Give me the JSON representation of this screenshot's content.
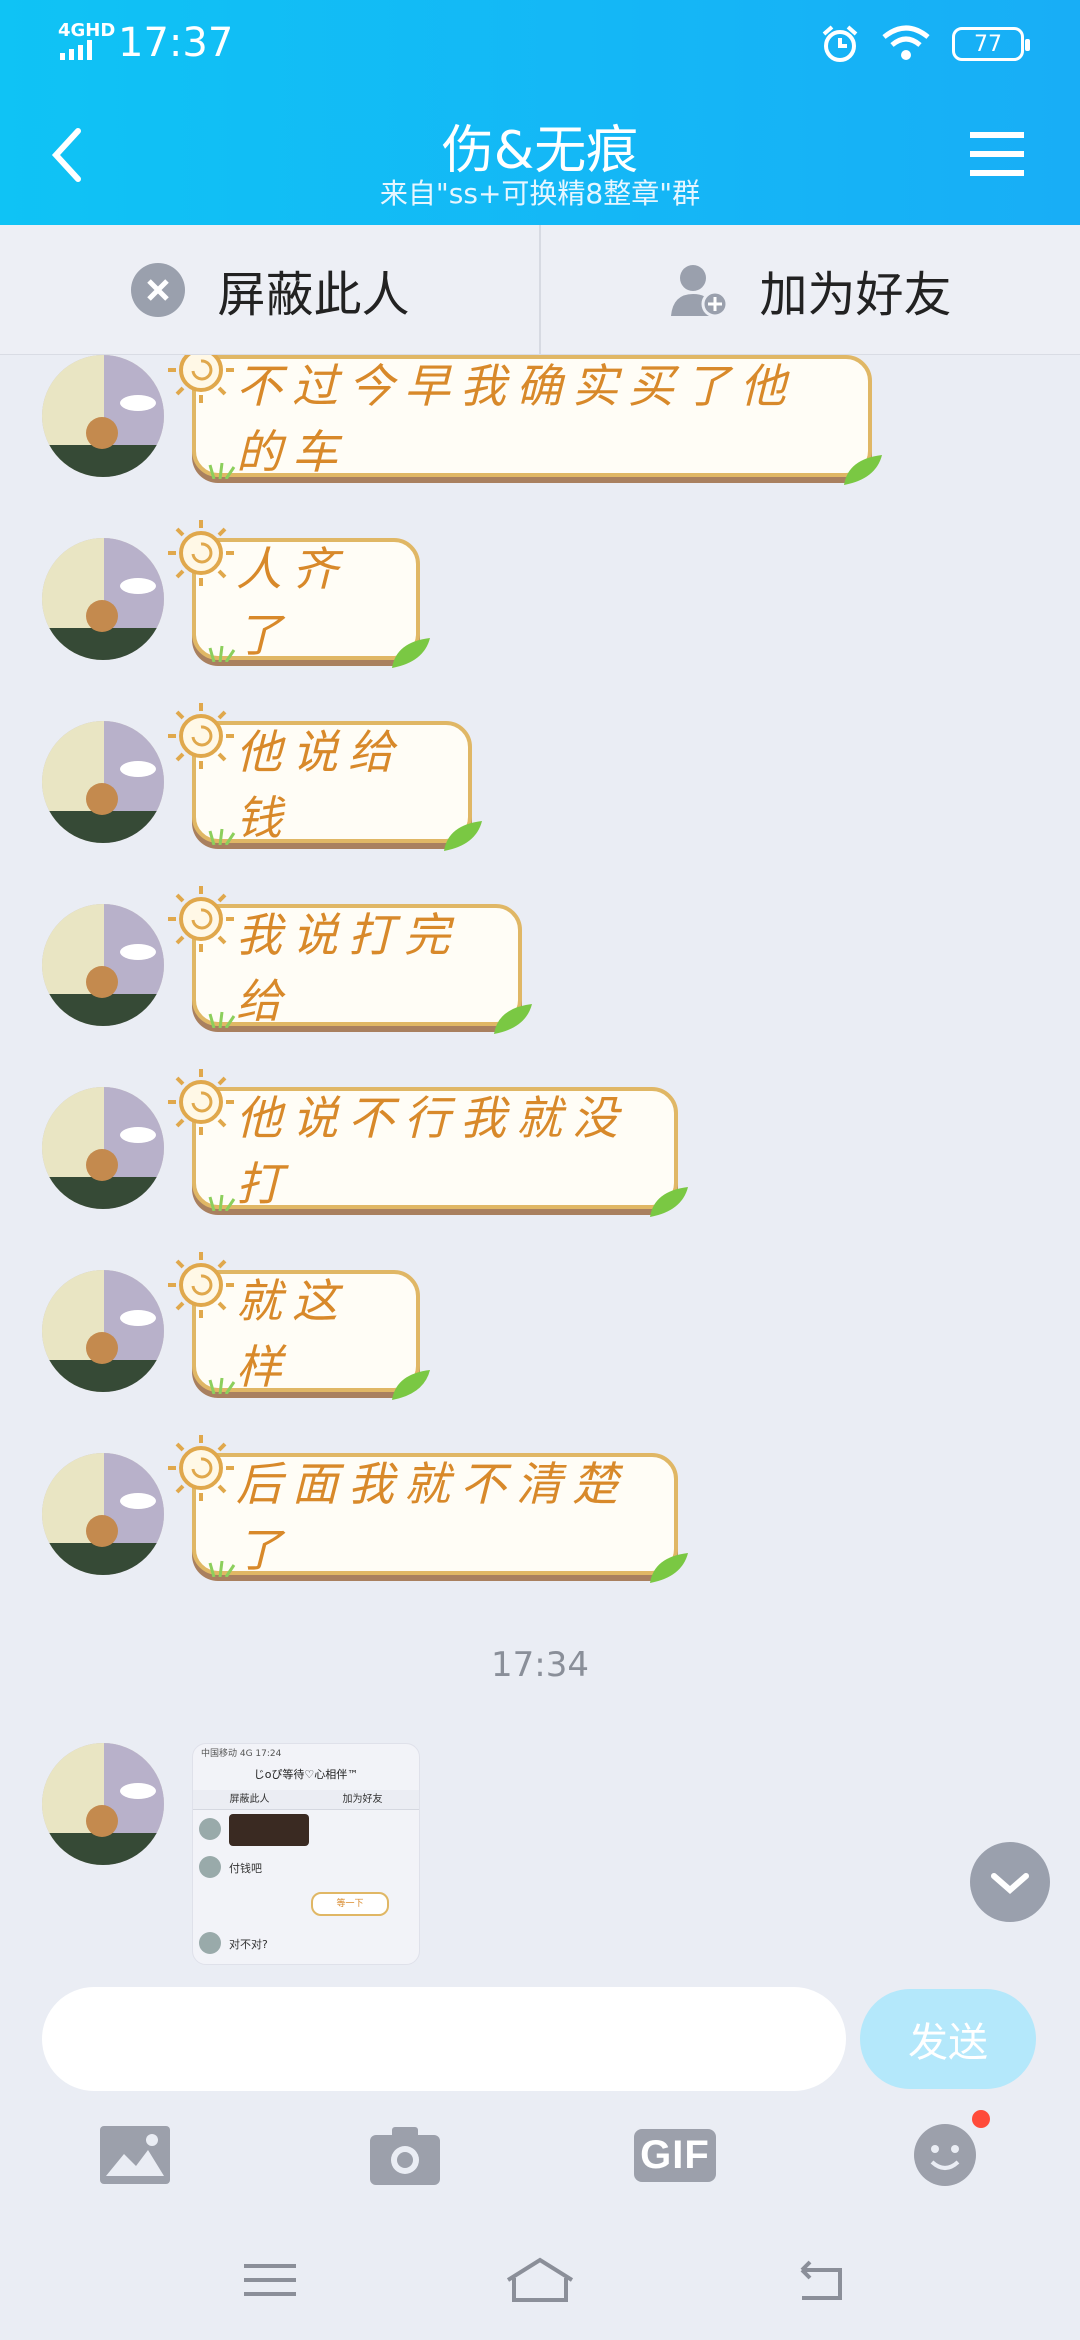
{
  "status_bar": {
    "network": "4GHD",
    "time": "17:37",
    "battery": "77"
  },
  "header": {
    "title": "伤&无痕",
    "subtitle": "来自\"ss+可换精8整章\"群"
  },
  "actions": {
    "block_label": "屏蔽此人",
    "add_friend_label": "加为好友"
  },
  "messages": [
    {
      "text": "不过今早我确实买了他的车"
    },
    {
      "text": "人齐了"
    },
    {
      "text": "他说给钱"
    },
    {
      "text": "我说打完给"
    },
    {
      "text": "他说不行我就没打"
    },
    {
      "text": "就这样"
    },
    {
      "text": "后面我就不清楚了"
    }
  ],
  "timestamp": "17:34",
  "image_message": {
    "status": "中国移动 4G  17:24",
    "title": "じoぴ等待♡心相伴™",
    "block": "屏蔽此人",
    "add": "加为好友",
    "line1": "付钱吧",
    "bubble": "等一下",
    "line2": "对不对?"
  },
  "input": {
    "placeholder": "",
    "send_label": "发送"
  },
  "tools": {
    "gif_label": "GIF",
    "icons": [
      "image-icon",
      "camera-icon",
      "gif-icon",
      "emoji-icon"
    ]
  },
  "colors": {
    "header": "#0fc3f5",
    "bubble_text": "#d8892a",
    "bubble_border": "#e0b765",
    "send": "#b4e8fb"
  }
}
